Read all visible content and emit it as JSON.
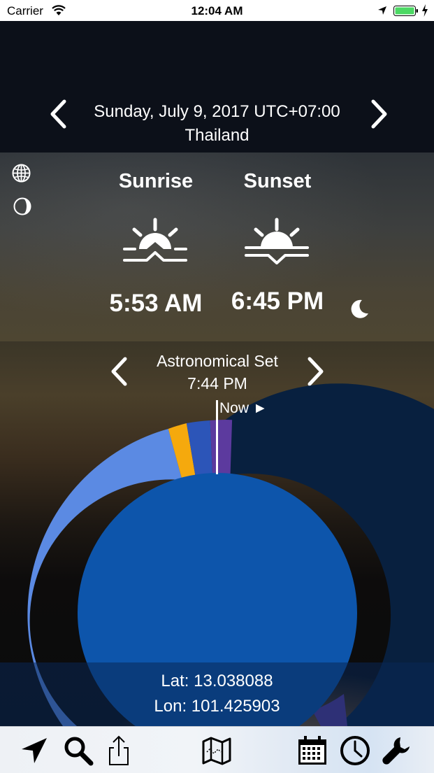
{
  "status_bar": {
    "carrier": "Carrier",
    "time": "12:04 AM"
  },
  "header": {
    "date": "Sunday, July 9, 2017 UTC+07:00",
    "location": "Thailand"
  },
  "sun": {
    "sunrise_label": "Sunrise",
    "sunset_label": "Sunset",
    "sunrise_time": "5:53 AM",
    "sunset_time": "6:45 PM"
  },
  "event": {
    "name": "Astronomical Set",
    "time": "7:44 PM"
  },
  "chart_data": {
    "type": "pie",
    "marker_label": "Now ►",
    "colors": {
      "night": "#08203f",
      "day": "#5b8ae3",
      "golden_hour": "#f5a90d",
      "twilight": "#2c55b8",
      "astronomical": "#5c3a9e",
      "center": "#0d55ab",
      "now_line": "#ffffff"
    }
  },
  "coords": {
    "lat": "Lat: 13.038088",
    "lon": "Lon: 101.425903"
  },
  "toolbar": {
    "icons": [
      "location-arrow-icon",
      "search-icon",
      "share-icon",
      "map-icon",
      "calendar-icon",
      "clock-icon",
      "wrench-icon"
    ]
  },
  "colors": {
    "status_bar_bg": "#ffffff",
    "battery": "#4cd964",
    "toolbar_icon": "#000000"
  }
}
